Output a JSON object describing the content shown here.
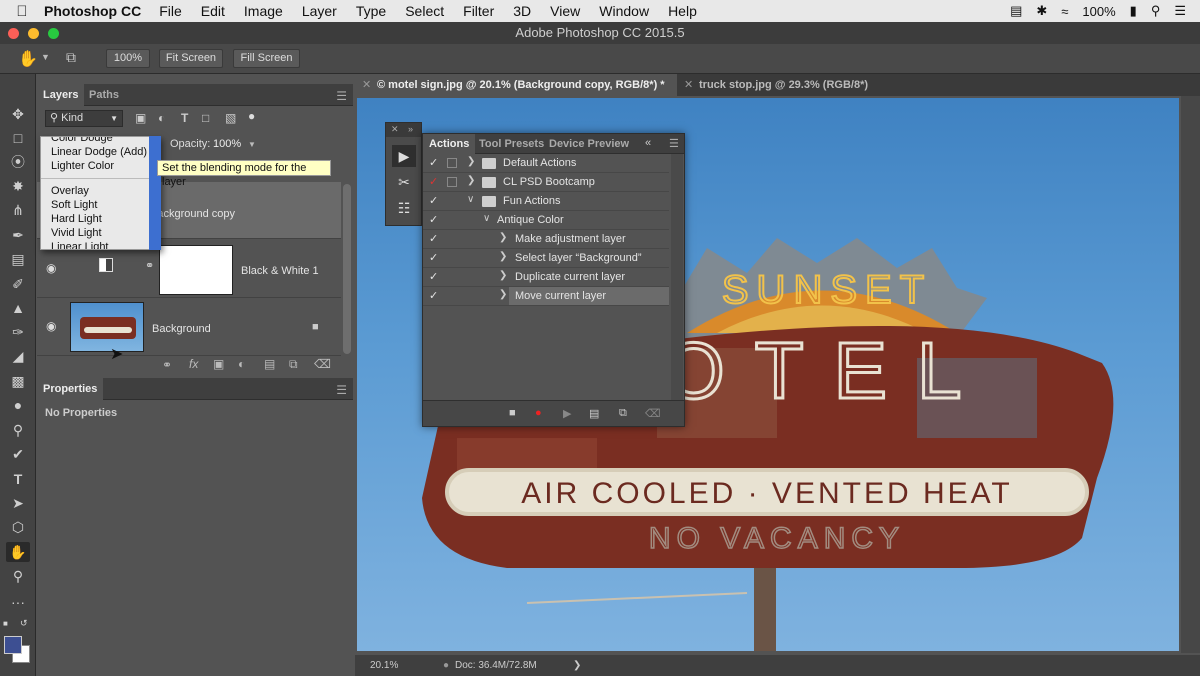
{
  "menubar": {
    "app": "Photoshop CC",
    "items": [
      "File",
      "Edit",
      "Image",
      "Layer",
      "Type",
      "Select",
      "Filter",
      "3D",
      "View",
      "Window",
      "Help"
    ],
    "battery": "100%"
  },
  "window": {
    "title": "Adobe Photoshop CC 2015.5"
  },
  "options": {
    "zoom": "100%",
    "fit": "Fit Screen",
    "fill": "Fill Screen"
  },
  "layers_panel": {
    "tabs": [
      "Layers",
      "Paths"
    ],
    "kind": "Kind",
    "opacity_label": "Opacity:",
    "opacity_value": "100%",
    "tooltip": "Set the blending mode for the layer",
    "blend_modes_group1": [
      "Color Dodge",
      "Linear Dodge (Add)",
      "Lighter Color"
    ],
    "blend_modes_group2": [
      "Overlay",
      "Soft Light",
      "Hard Light",
      "Vivid Light",
      "Linear Light"
    ],
    "layers": [
      {
        "name": "Background copy"
      },
      {
        "name": "Black & White 1"
      },
      {
        "name": "Background"
      }
    ]
  },
  "properties_panel": {
    "title": "Properties",
    "empty": "No Properties"
  },
  "doc_tabs": [
    {
      "label": "© motel sign.jpg @ 20.1% (Background copy, RGB/8*) *",
      "active": true
    },
    {
      "label": "truck stop.jpg @ 29.3% (RGB/8*)",
      "active": false
    }
  ],
  "status": {
    "zoom": "20.1%",
    "doc": "Doc: 36.4M/72.8M"
  },
  "actions_panel": {
    "tabs": [
      "Actions",
      "Tool Presets",
      "Device Preview"
    ],
    "rows": [
      {
        "label": "Default Actions",
        "kind": "set"
      },
      {
        "label": "CL PSD Bootcamp",
        "kind": "set"
      },
      {
        "label": "Fun Actions",
        "kind": "set"
      },
      {
        "label": "Antique Color",
        "kind": "action"
      },
      {
        "label": "Make adjustment layer",
        "kind": "step"
      },
      {
        "label": "Select layer “Background”",
        "kind": "step"
      },
      {
        "label": "Duplicate current layer",
        "kind": "step"
      },
      {
        "label": "Move current layer",
        "kind": "step"
      }
    ]
  },
  "sign": {
    "top": "SUNSET",
    "mid": "OTEL",
    "band": "AIR COOLED · VENTED HEAT",
    "bottom": "NO VACANCY"
  },
  "colors": {
    "sky": "#4f90ce",
    "sign_red": "#7a2e22",
    "accent_yellow": "#e0a32c"
  }
}
